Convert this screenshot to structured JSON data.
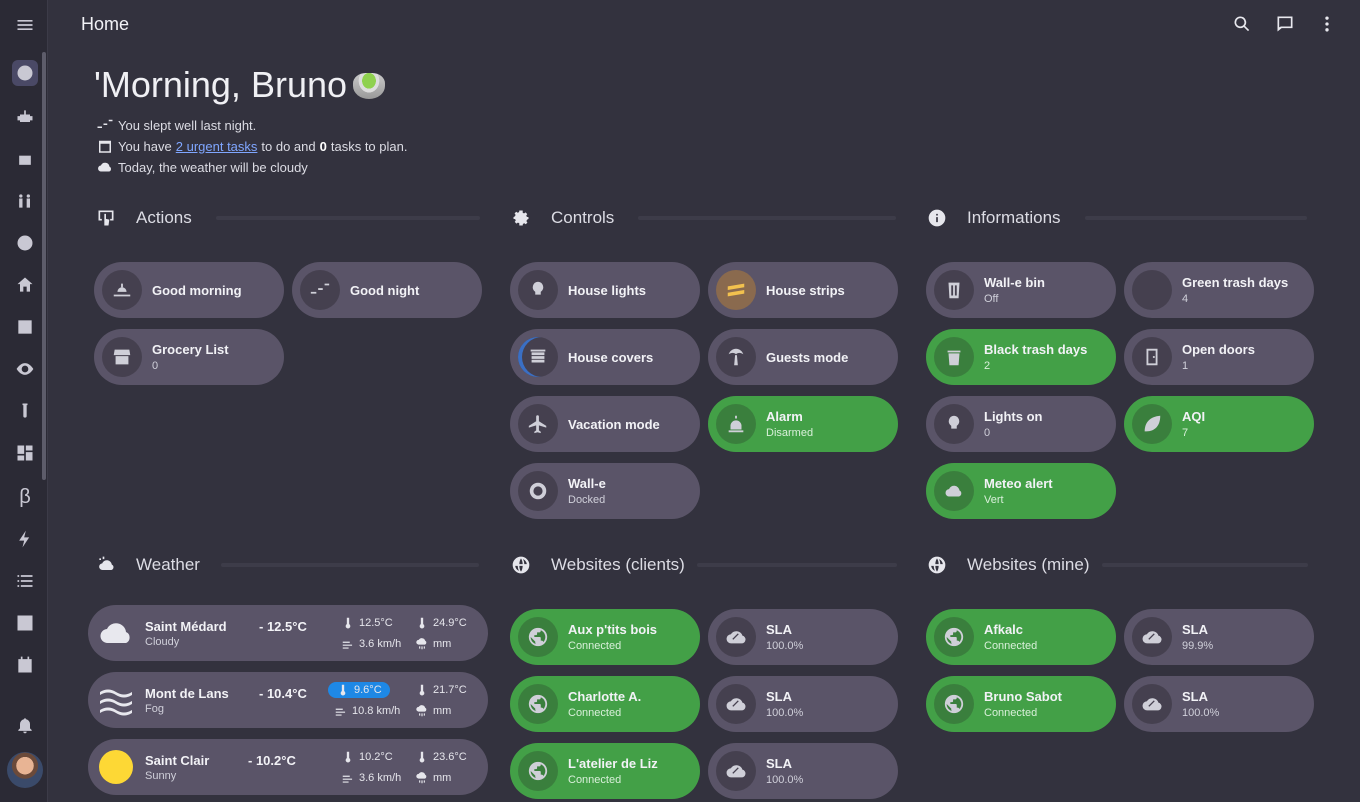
{
  "topbar": {
    "title": "Home"
  },
  "greeting": {
    "text": "'Morning, Bruno"
  },
  "summary": {
    "sleep": "You slept well last night.",
    "tasks_prefix": "You have",
    "tasks_link": "2 urgent tasks",
    "tasks_mid": "to do and",
    "tasks_count": "0",
    "tasks_suffix": "tasks to plan.",
    "weather": "Today, the weather will be cloudy"
  },
  "sections": {
    "actions": "Actions",
    "controls": "Controls",
    "informations": "Informations",
    "weather": "Weather",
    "websites_clients": "Websites (clients)",
    "websites_mine": "Websites (mine)"
  },
  "actions": [
    {
      "name": "Good morning",
      "state": ""
    },
    {
      "name": "Good night",
      "state": ""
    },
    {
      "name": "Grocery List",
      "state": "0"
    }
  ],
  "controls": [
    {
      "name": "House lights",
      "state": ""
    },
    {
      "name": "House strips",
      "state": ""
    },
    {
      "name": "House covers",
      "state": ""
    },
    {
      "name": "Guests mode",
      "state": ""
    },
    {
      "name": "Vacation mode",
      "state": ""
    },
    {
      "name": "Alarm",
      "state": "Disarmed"
    },
    {
      "name": "Wall-e",
      "state": "Docked"
    }
  ],
  "informations": [
    {
      "name": "Wall-e bin",
      "state": "Off"
    },
    {
      "name": "Green trash days",
      "state": "4"
    },
    {
      "name": "Black trash days",
      "state": "2"
    },
    {
      "name": "Open doors",
      "state": "1"
    },
    {
      "name": "Lights on",
      "state": "0"
    },
    {
      "name": "AQI",
      "state": "7"
    },
    {
      "name": "Meteo alert",
      "state": "Vert"
    }
  ],
  "weather": [
    {
      "city": "Saint Médard",
      "temp": "- 12.5°C",
      "cond": "Cloudy",
      "tmin": "12.5°C",
      "tmax": "24.9°C",
      "wind": "3.6 km/h",
      "rain": "mm"
    },
    {
      "city": "Mont de Lans",
      "temp": "- 10.4°C",
      "cond": "Fog",
      "tmin": "9.6°C",
      "tmax": "21.7°C",
      "wind": "10.8 km/h",
      "rain": "mm"
    },
    {
      "city": "Saint Clair",
      "temp": "- 10.2°C",
      "cond": "Sunny",
      "tmin": "10.2°C",
      "tmax": "23.6°C",
      "wind": "3.6 km/h",
      "rain": "mm"
    }
  ],
  "websites_clients": [
    {
      "name": "Aux p'tits bois",
      "state": "Connected"
    },
    {
      "name": "SLA",
      "state": "100.0%"
    },
    {
      "name": "Charlotte A.",
      "state": "Connected"
    },
    {
      "name": "SLA",
      "state": "100.0%"
    },
    {
      "name": "L'atelier de Liz",
      "state": "Connected"
    },
    {
      "name": "SLA",
      "state": "100.0%"
    }
  ],
  "websites_mine": [
    {
      "name": "Afkalc",
      "state": "Connected"
    },
    {
      "name": "SLA",
      "state": "99.9%"
    },
    {
      "name": "Bruno Sabot",
      "state": "Connected"
    },
    {
      "name": "SLA",
      "state": "100.0%"
    }
  ],
  "colors": {
    "on": "#43a047",
    "off": "#5a5468",
    "bg": "#33323e",
    "highlight": "#1e88e5"
  }
}
